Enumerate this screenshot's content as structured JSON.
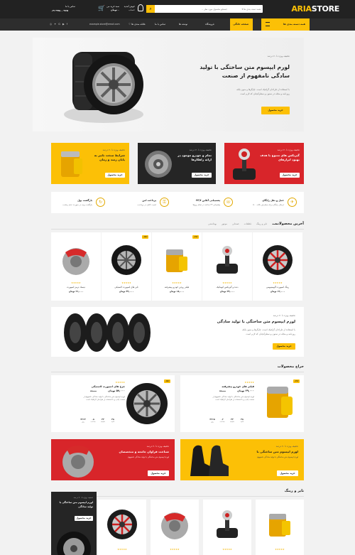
{
  "header": {
    "logo_left": "ARIA",
    "logo_right": "STORE",
    "search_placeholder": "جستجو محصول مورد نظر ...",
    "category_select": "همه دسته بندی ها",
    "cart_label": "سبد خرید من",
    "cart_total": "۰ تومان",
    "account_label": "خوش آمدید",
    "account_sub": "حساب",
    "phone_label": "تماس با ما",
    "phone_number": "۰۲۱-۹۹۸۰۰-۷۶۵"
  },
  "nav": {
    "categories_button": "همه دسته بندی ها",
    "items": [
      "صفحه خانگی",
      "فروشگاه",
      "نوشته ها",
      "تماس با ما"
    ],
    "wishlist": "علاقه مندی ها",
    "email": "example.store@email.com"
  },
  "hero": {
    "tagline": "تخفیف ویژه تا ۷۰ درصد",
    "title_line1": "لورم ایپسوم متن ساختگی با تولید",
    "title_line2": "سادگی نامفهوم از صنعت",
    "desc_line1": "با استفاده از طراحان گرافیک است، چاپگرها و متون بلکه",
    "desc_line2": "روزنامه و مجله در ستون و سطرآنچنان که لازم است",
    "button": "خرید محصول"
  },
  "promos": [
    {
      "tagline": "تخفیف ویژه تا ۷۰ درصد",
      "title1": "گیربکس های متنوع با هدف",
      "title2": "بهبود ابزارهای",
      "button": "خرید محصول"
    },
    {
      "tagline": "تخفیف ویژه تا ۷۰ درصد",
      "title1": "تمام و خودرو موجود در",
      "title2": "ارائه راهکارها",
      "button": "خرید محصول"
    },
    {
      "tagline": "تخفیف ویژه تا ۷۰ درصد",
      "title1": "شرایط سخت تاثیر به",
      "title2": "پایان رسد و زمان",
      "button": "خرید محصول"
    }
  ],
  "features": [
    {
      "title": "حمل و نقل رایگان",
      "sub": "ارسال رایگان برای سفارش بالای ۵۰۰",
      "icon": "plane-icon"
    },
    {
      "title": "پشتیبانی آنلاین ۲۴/۷",
      "sub": "پشتیبانی ۲۴ ساعته در تمام روزها",
      "icon": "support-icon"
    },
    {
      "title": "پرداخت امن",
      "sub": "امنیت کامل در پرداخت",
      "icon": "lock-icon"
    },
    {
      "title": "بازگشت پول",
      "sub": "بازگشت وجه در صورت عدم رضایت",
      "icon": "refund-icon"
    }
  ],
  "latest": {
    "title": "آخرین محصولات",
    "tabs": [
      "همه",
      "تایر و رینگ",
      "قطعات",
      "صندلی",
      "موتور",
      "بهداشتی"
    ],
    "products": [
      {
        "name": "رینگ اسپورت آلومینیومی",
        "price": "۱۲,۰۰۰ تومان",
        "badge": "",
        "kind": "rim"
      },
      {
        "name": "دنده و گیربکس اتوماتیک",
        "price": "۲۴,۰۰۰ تومان",
        "badge": "",
        "kind": "gear"
      },
      {
        "name": "فیلتر روغن خودرو پیشرفته",
        "price": "۱۸,۰۰۰ تومان",
        "badge": "-۱۷٪",
        "kind": "filter"
      },
      {
        "name": "تایر های اسپورت لاستیکی",
        "price": "۳۲,۰۰۰ تومان",
        "badge": "-۱۵٪",
        "kind": "tire"
      },
      {
        "name": "دیسک ترمز اسپورت",
        "price": "۲۱,۰۰۰ تومان",
        "badge": "",
        "kind": "brake"
      }
    ]
  },
  "mid_banner": {
    "tagline": "تخفیف ویژه تا ۷۰ درصد",
    "title": "لورم ایپسوم متن ساختگی با تولید سادگی",
    "desc_line1": "با استفاده از طراحان گرافیک است، چاپگرها و متون بلکه",
    "desc_line2": "روزنامه و مجله در ستون و سطرآنچنان که لازم است",
    "button": "خرید محصول"
  },
  "deals": {
    "title": "حراج محصولات",
    "items": [
      {
        "badge": "-۱۷٪",
        "name": "فیلتر های خودرو پیشرفته",
        "price": "۳۹,۰۰۰ تومان",
        "old": "۴۴,۰۰۰",
        "desc": "لورم ایپسوم متن ساختگی با تولید سادگی نامفهوم از صنعت چاپ و با استفاده از طراحان گرافیک است",
        "countdown": [
          {
            "v": "۳۲۶۵",
            "l": "روز"
          },
          {
            "v": "۰۲",
            "l": "ساعت"
          },
          {
            "v": "۴۴",
            "l": "دقیقه"
          },
          {
            "v": "۳۸",
            "l": "ثانیه"
          }
        ],
        "kind": "filter"
      },
      {
        "badge": "-۱۵٪",
        "name": "چرخ های اسپورت لاستیکی",
        "price": "۵۷,۰۰۰ تومان",
        "old": "۶۷,۰۰۰",
        "desc": "لورم ایپسوم متن ساختگی با تولید سادگی نامفهوم از صنعت چاپ و با استفاده از طراحان گرافیک است",
        "countdown": [
          {
            "v": "۳۲۶۴",
            "l": "روز"
          },
          {
            "v": "۰۸",
            "l": "ساعت"
          },
          {
            "v": "۴۴",
            "l": "دقیقه"
          },
          {
            "v": "۳۸",
            "l": "ثانیه"
          }
        ],
        "kind": "tire"
      }
    ]
  },
  "bottom_promos": [
    {
      "tagline": "تخفیف ویژه تا ۷۰ درصد",
      "title": "لورم ایپسوم متن ساختگی با",
      "sub": "لورم ایپسوم متن ساختگی با تولید سادگی نامفهوم",
      "button": "خرید محصول"
    },
    {
      "tagline": "تخفیف ویژه تا ۷۰ درصد",
      "title": "شناخت فراوان جامعه و متخصصان",
      "sub": "لورم ایپسوم متن ساختگی با تولید سادگی نامفهوم",
      "button": "خرید محصول"
    }
  ],
  "tires": {
    "title": "تایر و رینگ",
    "side_tagline": "تخفیف ویژه تا ۷۰ درصد",
    "side_title1": "لورم ایپسوم متن ساختگی با",
    "side_title2": "تولید سادگی",
    "side_button": "خرید محصول"
  },
  "colors": {
    "accent": "#fcc006",
    "dark": "#222222",
    "red": "#d8252a"
  }
}
